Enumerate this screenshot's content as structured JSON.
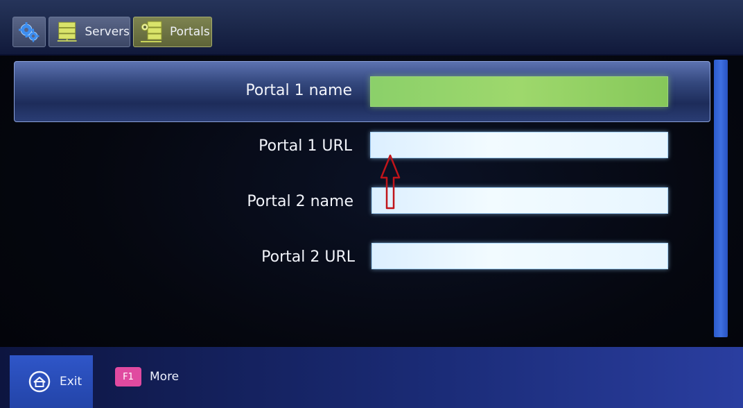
{
  "tabs": [
    {
      "id": "settings",
      "label": "",
      "icon": "gears-icon"
    },
    {
      "id": "servers",
      "label": "Servers",
      "icon": "server-icon"
    },
    {
      "id": "portals",
      "label": "Portals",
      "icon": "portal-server-icon",
      "active": true
    }
  ],
  "fields": [
    {
      "label": "Portal 1 name",
      "value": "",
      "state": "filled-green"
    },
    {
      "label": "Portal 1 URL",
      "value": ""
    },
    {
      "label": "Portal 2 name",
      "value": ""
    },
    {
      "label": "Portal 2 URL",
      "value": ""
    }
  ],
  "annotation": {
    "icon": "red-up-arrow-icon",
    "color": "#c0141a"
  },
  "footer": {
    "exit_label": "Exit",
    "f1_key": "F1",
    "more_label": "More"
  },
  "colors": {
    "active_tab": "#7d8350",
    "scrollbar": "#3e6fe0",
    "filled_field": "#8bd06a",
    "f1_key": "#e04aa0"
  }
}
